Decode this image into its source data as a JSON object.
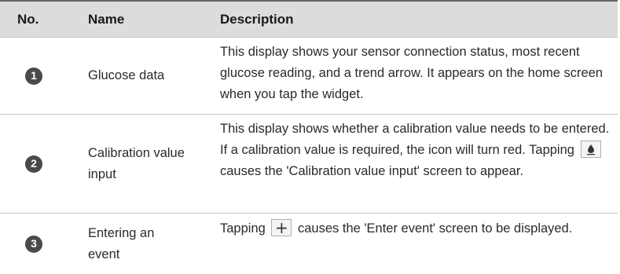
{
  "header": {
    "no": "No.",
    "name": "Name",
    "description": "Description"
  },
  "rows": [
    {
      "number": "1",
      "name": "Glucose data",
      "description": "This display shows your sensor connection status, most recent glucose reading, and a trend arrow. It appears on the home screen when you tap the widget."
    },
    {
      "number": "2",
      "name": "Calibration value input",
      "description_before_icon": "This display shows whether a calibration value needs to be entered. If a calibration value is required, the icon will turn red. Tapping",
      "icon": "calibration-drop-icon",
      "description_after_icon": "causes the 'Calibration value input' screen to appear."
    },
    {
      "number": "3",
      "name": "Entering an event",
      "description_before_icon": "Tapping",
      "icon": "plus-icon",
      "description_after_icon": "causes the 'Enter event' screen to be displayed."
    }
  ],
  "colors": {
    "header_bg": "#dcdcdc",
    "badge_bg": "#4a4a4a",
    "divider": "#c8c8c8"
  }
}
